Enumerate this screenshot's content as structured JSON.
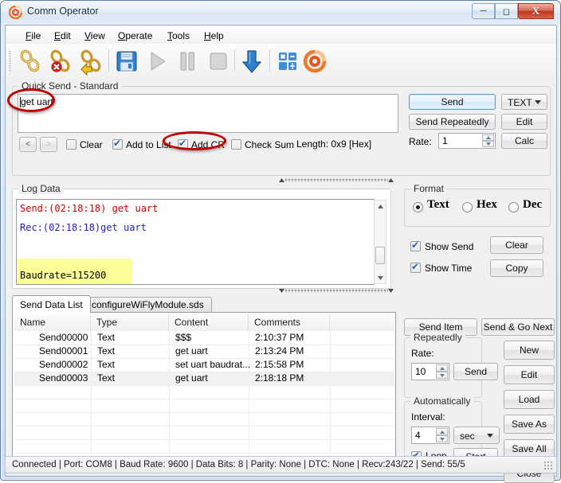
{
  "window": {
    "title": "Comm Operator",
    "app_icon": "target-icon",
    "minimize_label": "─",
    "maximize_label": "□",
    "close_label": "X"
  },
  "menu": [
    {
      "label": "File",
      "mnemonic": "F"
    },
    {
      "label": "Edit",
      "mnemonic": "E"
    },
    {
      "label": "View",
      "mnemonic": "V"
    },
    {
      "label": "Operate",
      "mnemonic": "O"
    },
    {
      "label": "Tools",
      "mnemonic": "T"
    },
    {
      "label": "Help",
      "mnemonic": "H"
    }
  ],
  "toolbar": {
    "buttons": [
      {
        "name": "connect-icon",
        "title": "Connect"
      },
      {
        "name": "disconnect-icon",
        "title": "Disconnect"
      },
      {
        "name": "reconnect-icon",
        "title": "Reconnect"
      },
      {
        "name": "save-icon",
        "title": "Save"
      },
      {
        "name": "play-icon",
        "title": "Start"
      },
      {
        "name": "pause-icon",
        "title": "Pause"
      },
      {
        "name": "stop-icon",
        "title": "Stop"
      },
      {
        "name": "download-arrow-icon",
        "title": "Receive"
      },
      {
        "name": "calculator-icon",
        "title": "Calculator"
      },
      {
        "name": "target-icon",
        "title": "About"
      }
    ]
  },
  "quick_send": {
    "group_title": "Quick Send - Standard",
    "input_value": "get uart",
    "prev_label": "<",
    "next_label": ">",
    "checkboxes": [
      {
        "label": "Clear",
        "checked": false
      },
      {
        "label": "Add to List",
        "checked": true
      },
      {
        "label": "Add CR",
        "checked": true
      },
      {
        "label": "Check Sum",
        "checked": false
      }
    ],
    "length_label": "Length: 0x9 [Hex]",
    "send_label": "Send",
    "send_repeatedly_label": "Send Repeatedly",
    "rate_label": "Rate:",
    "rate_value": "1",
    "format_value": "TEXT",
    "edit_label": "Edit",
    "calc_label": "Calc"
  },
  "log": {
    "group_title": "Log Data",
    "lines": [
      {
        "text": "Send:(02:18:18) get uart",
        "color": "#d40000",
        "highlight": false
      },
      {
        "text": "Rec:(02:18:18)get uart",
        "color": "#2020d0",
        "highlight": false
      },
      {
        "text": "Baudrate=115200",
        "color": "#000000",
        "highlight": true
      }
    ],
    "highlight_color": "#ffff99"
  },
  "format": {
    "group_title": "Format",
    "options": [
      {
        "label": "Text",
        "selected": true
      },
      {
        "label": "Hex",
        "selected": false
      },
      {
        "label": "Dec",
        "selected": false
      }
    ],
    "show_send": {
      "label": "Show Send",
      "checked": true
    },
    "show_time": {
      "label": "Show Time",
      "checked": true
    },
    "clear_label": "Clear",
    "copy_label": "Copy"
  },
  "tabs": [
    {
      "label": "Send Data List",
      "active": true
    },
    {
      "label": "configureWiFlyModule.sds",
      "active": false
    }
  ],
  "table": {
    "columns": [
      "Name",
      "Type",
      "Content",
      "Comments"
    ],
    "rows": [
      {
        "name": "Send00000",
        "type": "Text",
        "content": "$$$",
        "comments": "2:10:37 PM",
        "selected": false
      },
      {
        "name": "Send00001",
        "type": "Text",
        "content": "get uart",
        "comments": "2:13:24 PM",
        "selected": false
      },
      {
        "name": "Send00002",
        "type": "Text",
        "content": "set uart baudrat...",
        "comments": "2:15:58 PM",
        "selected": false
      },
      {
        "name": "Send00003",
        "type": "Text",
        "content": "get uart",
        "comments": "2:18:18 PM",
        "selected": true
      }
    ]
  },
  "send_panel": {
    "send_item_label": "Send Item",
    "send_go_next_label": "Send & Go Next",
    "repeatedly": {
      "group_title": "Repeatedly",
      "rate_label": "Rate:",
      "rate_value": "10",
      "send_label": "Send"
    },
    "automatically": {
      "group_title": "Automatically",
      "interval_label": "Interval:",
      "interval_value": "4",
      "unit_value": "sec",
      "loop_label": "Loop",
      "loop_checked": true,
      "start_label": "Start"
    },
    "actions": [
      {
        "label": "New"
      },
      {
        "label": "Edit"
      },
      {
        "label": "Load"
      },
      {
        "label": "Save As"
      },
      {
        "label": "Save All"
      },
      {
        "label": "Close"
      }
    ]
  },
  "status_bar": {
    "text": "Connected | Port: COM8 | Baud Rate: 9600 | Data Bits: 8 | Parity: None | DTC: None | Recv:243/22 | Send: 55/5"
  },
  "annotations": {
    "accent_color": "#c00000",
    "items": [
      {
        "name": "annotation-ellipse-input",
        "target": "quick-send-input-text"
      },
      {
        "name": "annotation-ellipse-add-cr",
        "target": "add-cr-checkbox"
      }
    ]
  }
}
